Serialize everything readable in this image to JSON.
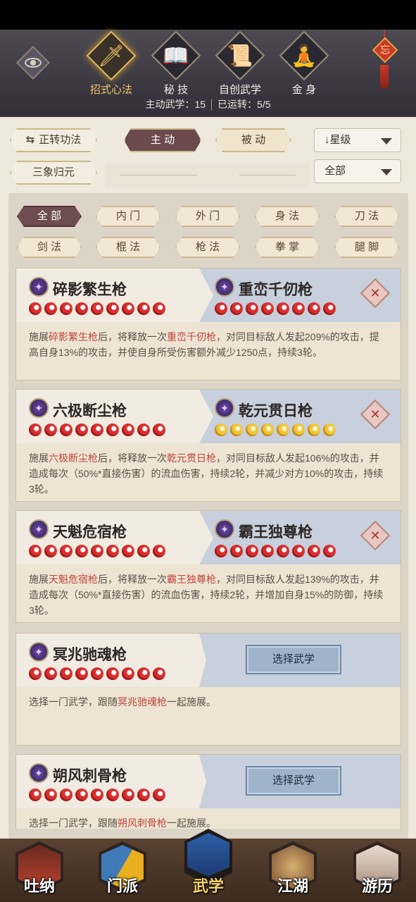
{
  "header": {
    "tabs": [
      {
        "label": "招式心法",
        "icon": "sword-icon",
        "active": true
      },
      {
        "label": "秘 技",
        "icon": "book-icon",
        "active": false
      },
      {
        "label": "自创武学",
        "icon": "scroll-icon",
        "active": false
      },
      {
        "label": "金 身",
        "icon": "meditation-icon",
        "active": false
      }
    ],
    "knot_char": "忘",
    "active_label": "主动武学：15",
    "circulated_label": "已运转：5/5"
  },
  "controls": {
    "reverse_label": "正转功法",
    "active_tab": "主 动",
    "passive_tab": "被 动",
    "sort_value": "↓星级",
    "sanxiang_label": "三象归元",
    "filter_value": "全部"
  },
  "filters": [
    "全 部",
    "内 门",
    "外 门",
    "身 法",
    "刀 法",
    "剑 法",
    "棍 法",
    "枪 法",
    "拳 掌",
    "腿 脚"
  ],
  "combos": [
    {
      "left": "碎影繁生枪",
      "right": "重峦千仞枪",
      "right_gold": false,
      "desc": {
        "a": "施展",
        "s1": "碎影繁生枪",
        "b": "后，将释放一次",
        "s2": "重峦千仞枪",
        "c": "，对同目标敌人发起209%的攻击，提高自身13%的攻击，并使自身所受伤害额外减少1250点，持续3轮。"
      }
    },
    {
      "left": "六极断尘枪",
      "right": "乾元贯日枪",
      "right_gold": true,
      "desc": {
        "a": "施展",
        "s1": "六极断尘枪",
        "b": "后，将释放一次",
        "s2": "乾元贯日枪",
        "c": "，对同目标敌人发起106%的攻击，并造成每次（50%*直接伤害）的流血伤害，持续2轮，并减少对方10%的攻击，持续3轮。"
      }
    },
    {
      "left": "天魁危宿枪",
      "right": "霸王独尊枪",
      "right_gold": false,
      "desc": {
        "a": "施展",
        "s1": "天魁危宿枪",
        "b": "后，将释放一次",
        "s2": "霸王独尊枪",
        "c": "，对同目标敌人发起139%的攻击，并造成每次（50%*直接伤害）的流血伤害，持续2轮，并增加自身15%的防御，持续3轮。"
      }
    },
    {
      "left": "冥兆驰魂枪",
      "button": "选择武学",
      "desc": {
        "a": "选择一门武学，跟随",
        "s1": "冥兆驰魂枪",
        "b": "一起施展。"
      }
    },
    {
      "left": "朔风刺骨枪",
      "button": "选择武学",
      "desc": {
        "a": "选择一门武学，跟随",
        "s1": "朔风刺骨枪",
        "b": "一起施展。"
      }
    }
  ],
  "nav": [
    {
      "label": "吐纳",
      "icon": "monk-icon",
      "color": "#b8402c"
    },
    {
      "label": "门派",
      "icon": "banner-icon",
      "color": "#3f7ab8"
    },
    {
      "label": "武学",
      "icon": "manual-icon",
      "color": "#2d5fa8",
      "active": true
    },
    {
      "label": "江湖",
      "icon": "straw-hat-icon",
      "color": "#a07040"
    },
    {
      "label": "游历",
      "icon": "horse-icon",
      "color": "#c9b8a8"
    }
  ]
}
